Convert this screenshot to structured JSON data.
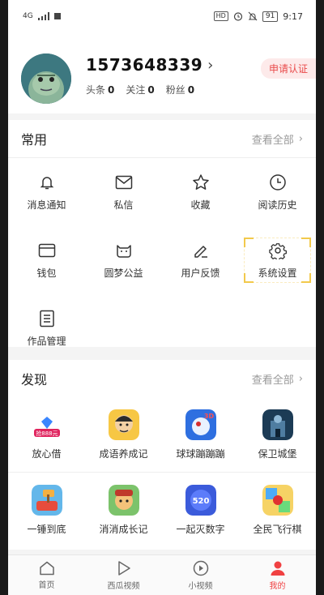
{
  "status_bar": {
    "signal": "4G",
    "hd": "HD",
    "battery": "91",
    "time": "9:17"
  },
  "profile": {
    "username": "1573648339",
    "stats": [
      {
        "label": "头条",
        "value": "0"
      },
      {
        "label": "关注",
        "value": "0"
      },
      {
        "label": "粉丝",
        "value": "0"
      }
    ],
    "certify_label": "申请认证"
  },
  "common": {
    "title": "常用",
    "see_all": "查看全部",
    "items": [
      {
        "label": "消息通知",
        "icon": "bell-icon"
      },
      {
        "label": "私信",
        "icon": "mail-icon"
      },
      {
        "label": "收藏",
        "icon": "star-icon"
      },
      {
        "label": "阅读历史",
        "icon": "clock-icon"
      },
      {
        "label": "钱包",
        "icon": "wallet-icon"
      },
      {
        "label": "圆梦公益",
        "icon": "charity-icon"
      },
      {
        "label": "用户反馈",
        "icon": "pen-icon"
      },
      {
        "label": "系统设置",
        "icon": "gear-icon"
      },
      {
        "label": "作品管理",
        "icon": "document-icon"
      }
    ]
  },
  "discover": {
    "title": "发现",
    "see_all": "查看全部",
    "items": [
      {
        "label": "放心借",
        "icon": "fangxinjie-app-icon",
        "badge": "抢888元"
      },
      {
        "label": "成语养成记",
        "icon": "chengyu-app-icon"
      },
      {
        "label": "球球蹦蹦蹦",
        "icon": "qiuqiu-app-icon",
        "badge": "3D"
      },
      {
        "label": "保卫城堡",
        "icon": "castle-app-icon"
      },
      {
        "label": "一锤到底",
        "icon": "hammer-app-icon"
      },
      {
        "label": "消消成长记",
        "icon": "xiaoxiao-app-icon"
      },
      {
        "label": "一起灭数字",
        "icon": "number-app-icon",
        "badge": "520"
      },
      {
        "label": "全民飞行棋",
        "icon": "flight-chess-app-icon"
      }
    ]
  },
  "tabbar": {
    "items": [
      {
        "label": "首页",
        "icon": "home-icon"
      },
      {
        "label": "西瓜视频",
        "icon": "play-icon"
      },
      {
        "label": "小视频",
        "icon": "small-video-icon"
      },
      {
        "label": "我的",
        "icon": "person-icon"
      }
    ],
    "active_color": "#f04142"
  }
}
